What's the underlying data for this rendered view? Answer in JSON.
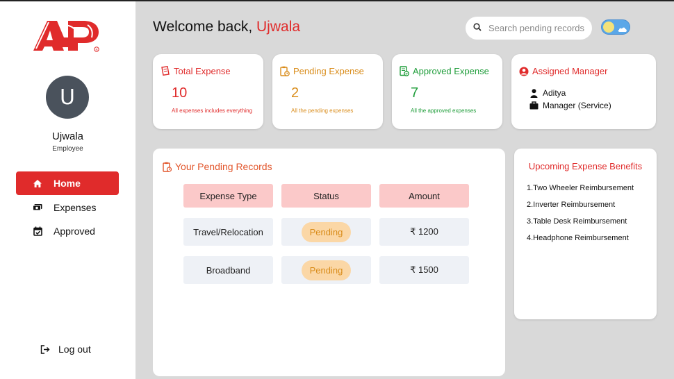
{
  "brand": {
    "name": "ADP",
    "accent": "#e02b2b"
  },
  "user": {
    "initial": "U",
    "name": "Ujwala",
    "role": "Employee"
  },
  "nav": [
    {
      "label": "Home",
      "icon": "home-icon",
      "active": true
    },
    {
      "label": "Expenses",
      "icon": "money-icon",
      "active": false
    },
    {
      "label": "Approved",
      "icon": "calendar-check-icon",
      "active": false
    }
  ],
  "logout": {
    "label": "Log out",
    "icon": "logout-icon"
  },
  "header": {
    "welcome": "Welcome back,",
    "name": "Ujwala"
  },
  "search": {
    "placeholder": "Search pending records",
    "value": ""
  },
  "theme_toggle": {
    "state": "light"
  },
  "cards": {
    "total": {
      "title": "Total Expense",
      "value": "10",
      "subtitle": "All expenses includes everything",
      "icon": "receipt-icon"
    },
    "pending": {
      "title": "Pending Expense",
      "value": "2",
      "subtitle": "All the pending expenses",
      "icon": "clipboard-clock-icon"
    },
    "approved": {
      "title": "Approved Expense",
      "value": "7",
      "subtitle": "All the approved expenses",
      "icon": "document-check-icon"
    },
    "manager": {
      "title": "Assigned Manager",
      "name": "Aditya",
      "position": "Manager (Service)",
      "icon": "user-circle-icon"
    }
  },
  "pending_records": {
    "title": "Your Pending Records",
    "columns": [
      "Expense Type",
      "Status",
      "Amount"
    ],
    "rows": [
      {
        "type": "Travel/Relocation",
        "status": "Pending",
        "amount": "₹ 1200"
      },
      {
        "type": "Broadband",
        "status": "Pending",
        "amount": "₹ 1500"
      }
    ]
  },
  "benefits": {
    "title": "Upcoming Expense Benefits",
    "items": [
      "1.Two Wheeler Reimbursement",
      "2.Inverter Reimbursement",
      "3.Table Desk Reimbursement",
      "4.Headphone Reimbursement"
    ]
  }
}
